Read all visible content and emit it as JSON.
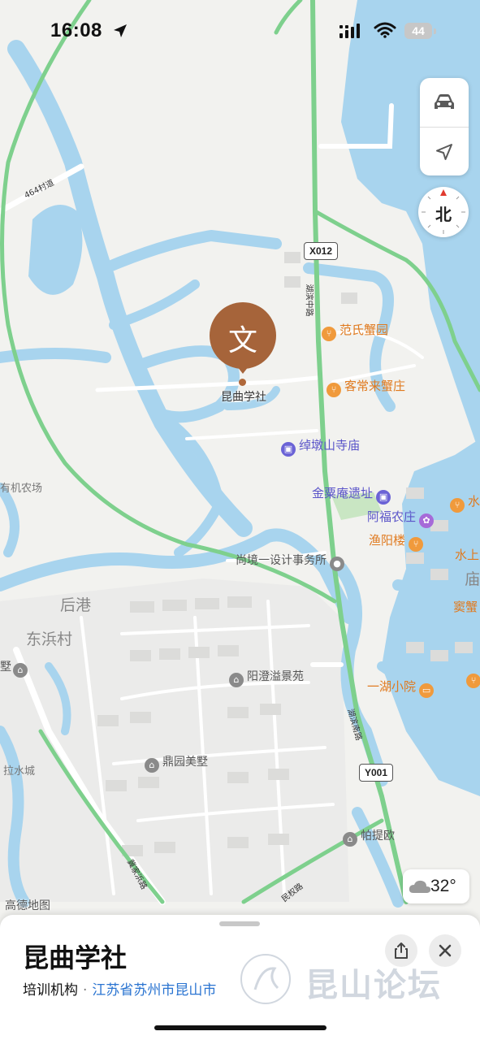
{
  "status_bar": {
    "time": "16:08",
    "battery": "44"
  },
  "map": {
    "compass_label": "北",
    "road_shields": [
      "X012",
      "Y001"
    ],
    "road_labels": [
      "464村道",
      "湖滨中路",
      "湖滨南路",
      "冀家浜路",
      "民权路"
    ],
    "area_labels": [
      "后港",
      "东浜村",
      "有机农场",
      "拉水城"
    ],
    "pois": {
      "fanshi": "范氏蟹园",
      "kechanglai": "客常来蟹庄",
      "chuodunshan": "绰墩山寺庙",
      "jinsuan": "金粟庵遗址",
      "afu": "阿福农庄",
      "yuyang": "渔阳楼",
      "shangjing": "尚境一设计事务所",
      "yangcheng": "阳澄溢景苑",
      "dingyuan": "鼎园美墅",
      "yihu": "一湖小院",
      "patiou": "帕提欧",
      "edge_shui": "水",
      "edge_shuishang": "水上",
      "edge_miao": "庙",
      "edge_douxie": "窦蟹",
      "edge_shu": "墅"
    },
    "selected": {
      "name": "昆曲学社",
      "glyph": "文",
      "color": "#a6643a"
    },
    "weather_temp": "32°",
    "provider_logo": "高德地图"
  },
  "sheet": {
    "title": "昆曲学社",
    "category": "培训机构",
    "separator": "·",
    "address_link": "江苏省苏州市昆山市",
    "watermark": "昆山论坛"
  },
  "colors": {
    "water": "#a8d4ee",
    "highway": "#7ed08d",
    "accent_link": "#2a74d1",
    "marker": "#a6643a"
  }
}
